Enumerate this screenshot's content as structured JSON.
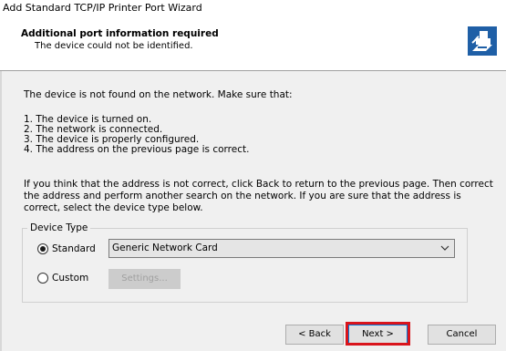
{
  "window": {
    "title": "Add Standard TCP/IP Printer Port Wizard"
  },
  "header": {
    "title": "Additional port information required",
    "subtitle": "The device could not be identified.",
    "icon": "printer-network-icon"
  },
  "intro": "The device is not found on the network. Make sure that:",
  "checklist": [
    "1.  The device is turned on.",
    "2.  The network is connected.",
    "3.  The device is properly configured.",
    "4.  The address on the previous page is correct."
  ],
  "instructions": "If you think that the address is not correct, click Back to return to the previous page. Then correct the address and perform another search on the network. If you are sure that the address is correct, select the device type below.",
  "device_type": {
    "legend": "Device Type",
    "standard_label": "Standard",
    "standard_selected": true,
    "custom_label": "Custom",
    "custom_selected": false,
    "standard_value": "Generic Network Card",
    "settings_label": "Settings..."
  },
  "buttons": {
    "back": "< Back",
    "next": "Next >",
    "cancel": "Cancel"
  },
  "colors": {
    "highlight": "#d9141b",
    "focus": "#0078d7"
  }
}
